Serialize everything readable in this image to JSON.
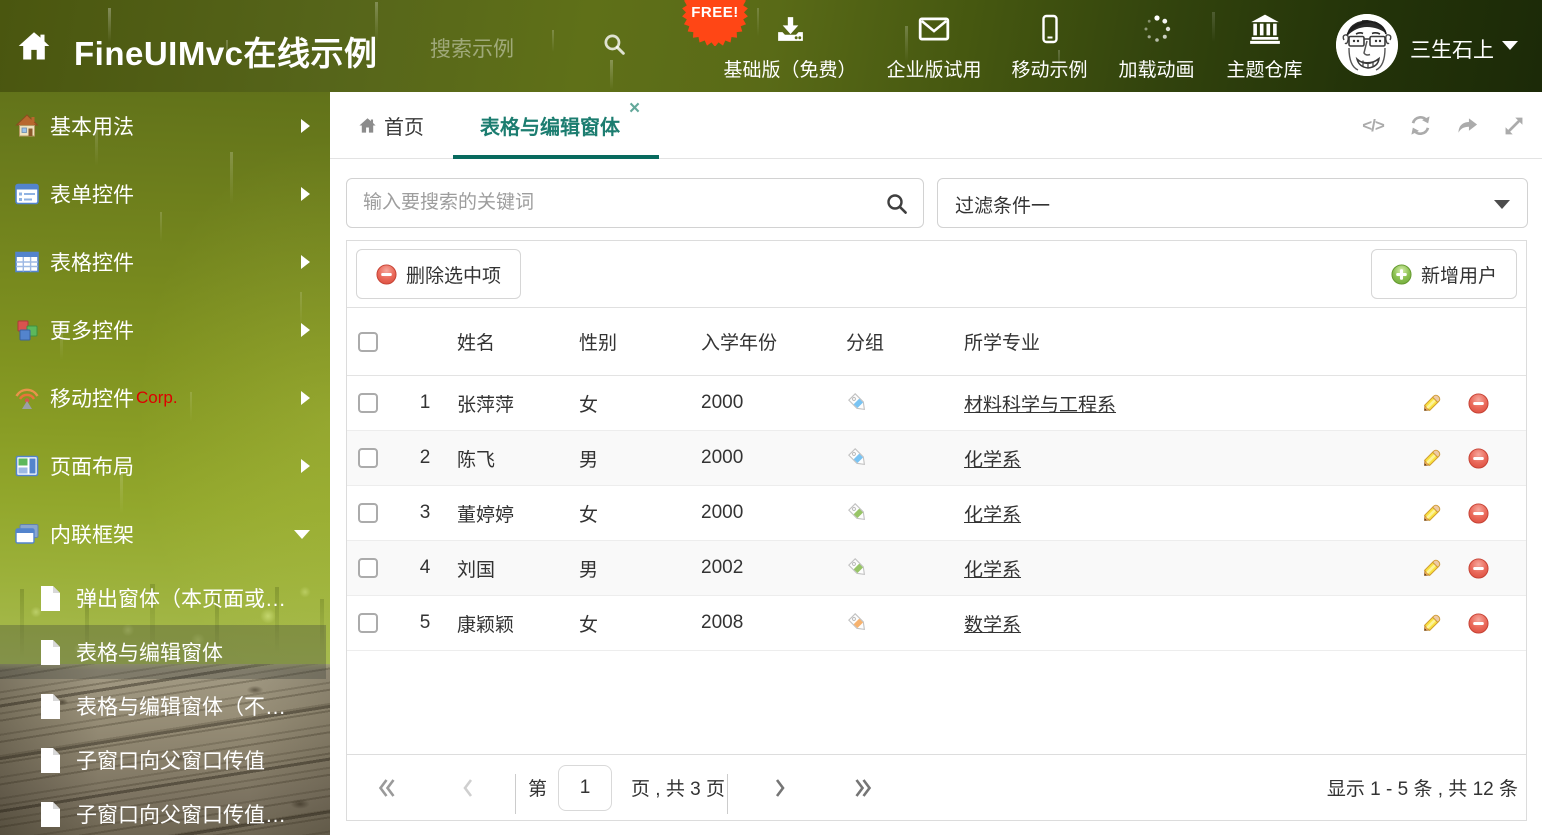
{
  "colors": {
    "accent_teal": "#1c7d70",
    "accent_teal_dark": "#086a5e",
    "header_olive": "#5a6a16",
    "free_badge_orange": "#ff4615",
    "danger_red": "#e05a4e",
    "success_green": "#7fbf4d",
    "link_text": "#333333",
    "row_alt": "#f9f9f9"
  },
  "header": {
    "title": "FineUIMvc在线示例",
    "search_placeholder": "搜索示例",
    "free_badge": "FREE!",
    "nav": [
      {
        "label": "基础版（免费）",
        "icon": "download-icon"
      },
      {
        "label": "企业版试用",
        "icon": "envelope-icon"
      },
      {
        "label": "移动示例",
        "icon": "mobile-icon"
      },
      {
        "label": "加载动画",
        "icon": "spinner-icon"
      },
      {
        "label": "主题仓库",
        "icon": "bank-icon"
      }
    ],
    "user": {
      "name": "三生石上"
    }
  },
  "sidebar": {
    "items": [
      {
        "label": "基本用法",
        "icon": "house-icon",
        "expanded": false
      },
      {
        "label": "表单控件",
        "icon": "form-icon",
        "expanded": false
      },
      {
        "label": "表格控件",
        "icon": "table-icon",
        "expanded": false
      },
      {
        "label": "更多控件",
        "icon": "cubes-icon",
        "expanded": false
      },
      {
        "label": "移动控件",
        "icon": "signal-icon",
        "badge": "Corp.",
        "expanded": false
      },
      {
        "label": "页面布局",
        "icon": "layout-icon",
        "expanded": false
      },
      {
        "label": "内联框架",
        "icon": "frames-icon",
        "expanded": true
      }
    ],
    "subitems": [
      {
        "label": "弹出窗体（本页面或…",
        "selected": false
      },
      {
        "label": "表格与编辑窗体",
        "selected": true
      },
      {
        "label": "表格与编辑窗体（不…",
        "selected": false
      },
      {
        "label": "子窗口向父窗口传值",
        "selected": false
      },
      {
        "label": "子窗口向父窗口传值…",
        "selected": false
      }
    ]
  },
  "tabs": {
    "home_label": "首页",
    "active_label": "表格与编辑窗体",
    "close": "×",
    "actions": [
      "code-icon",
      "refresh-icon",
      "share-icon",
      "expand-icon"
    ]
  },
  "filter": {
    "search_placeholder": "输入要搜索的关键词",
    "dropdown_value": "过滤条件一"
  },
  "toolbar": {
    "delete_label": "删除选中项",
    "add_label": "新增用户"
  },
  "table": {
    "columns": {
      "name": "姓名",
      "gender": "性别",
      "year": "入学年份",
      "group": "分组",
      "major": "所学专业"
    },
    "rows": [
      {
        "num": "1",
        "name": "张萍萍",
        "gender": "女",
        "year": "2000",
        "tag": "#79c3f2",
        "major": "材料科学与工程系"
      },
      {
        "num": "2",
        "name": "陈飞",
        "gender": "男",
        "year": "2000",
        "tag": "#79c3f2",
        "major": "化学系"
      },
      {
        "num": "3",
        "name": "董婷婷",
        "gender": "女",
        "year": "2000",
        "tag": "#97c467",
        "major": "化学系"
      },
      {
        "num": "4",
        "name": "刘国",
        "gender": "男",
        "year": "2002",
        "tag": "#97c467",
        "major": "化学系"
      },
      {
        "num": "5",
        "name": "康颖颖",
        "gender": "女",
        "year": "2008",
        "tag": "#f6b26e",
        "major": "数学系"
      }
    ]
  },
  "pagination": {
    "page_prefix": "第",
    "current_page": "1",
    "page_suffix": "页 , 共 3 页",
    "summary": "显示 1 - 5 条 , 共 12 条"
  }
}
